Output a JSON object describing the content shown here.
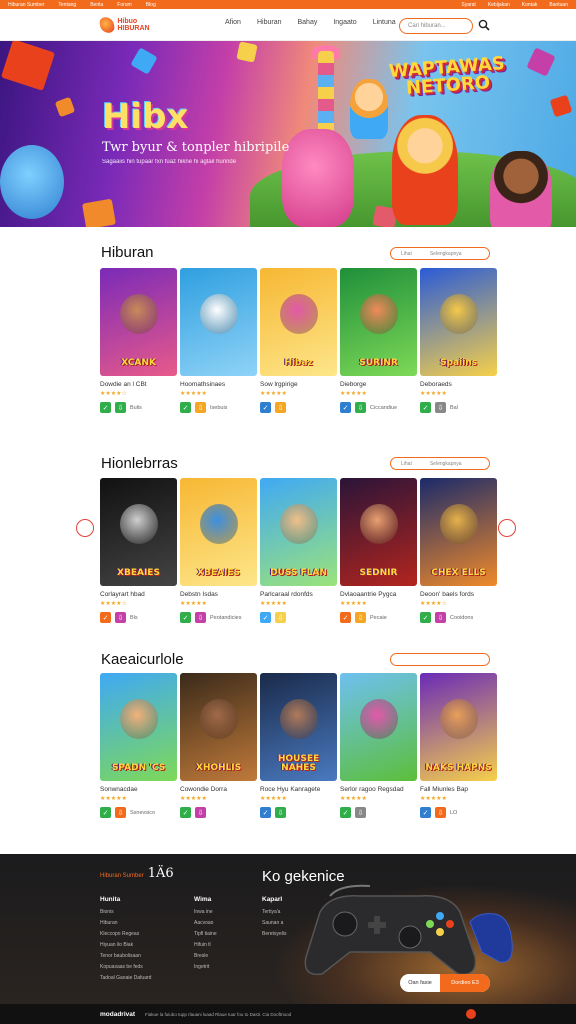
{
  "topbar": {
    "left": [
      "Hiburan Sumber",
      "Tentang",
      "Berita",
      "Forum",
      "Blog"
    ],
    "right": [
      "Syarat",
      "Kebijakan",
      "Kontak",
      "Bantuan"
    ]
  },
  "header": {
    "logo_text": "Hibuo HIBURAN",
    "nav": [
      "Afion",
      "Hiburan",
      "Bahay",
      "Ingaato",
      "Lintuna"
    ],
    "search_placeholder": "Cari hiburan..."
  },
  "hero": {
    "title": "Hibx",
    "subtitle": "Twr byur & tonpler hibripile",
    "caption": "Sagaaiis hin tupaar fxn fuaz hikne hi agtail hunnde",
    "badge": "WAPTAWAS NETORO"
  },
  "sections": [
    {
      "title": "Hiburan",
      "more": [
        "Lihat",
        "Selengkapnya"
      ],
      "cards": [
        {
          "thumb": "XCANK",
          "title": "Dowdie an l CBt",
          "stars": "★★★★☆",
          "action": "Bulis",
          "c1": "#7a2ab8",
          "c2": "#e85a8a",
          "face": "#c98a5a"
        },
        {
          "thumb": "",
          "title": "Hoomathsinaes",
          "stars": "★★★★★",
          "action": "Isebuis",
          "c1": "#2f9fe0",
          "c2": "#8fd3f7",
          "face": "#ffffff"
        },
        {
          "thumb": "Hibaz",
          "title": "Sow lrgpirige",
          "stars": "★★★★★",
          "action": "",
          "c1": "#f7b733",
          "c2": "#fde68a",
          "face": "#e35aa8"
        },
        {
          "thumb": "SURINR",
          "title": "Dieborge",
          "stars": "★★★★★",
          "action": "Ciccandiue",
          "c1": "#1e8f3a",
          "c2": "#7ed957",
          "face": "#f08a5a"
        },
        {
          "thumb": "Spaiins",
          "title": "Deboraeds",
          "stars": "★★★★★",
          "action": "Bal",
          "c1": "#2a5bd7",
          "c2": "#f6d04a",
          "face": "#f6c94a"
        }
      ]
    },
    {
      "title": "Hionlebrras",
      "more": [
        "Lihat",
        "Selengkapnya"
      ],
      "cards": [
        {
          "thumb": "XBEAIES",
          "title": "Corlayrart hbad",
          "stars": "★★★★☆",
          "action": "Bls",
          "c1": "#111111",
          "c2": "#444444",
          "face": "#cfcfcf"
        },
        {
          "thumb": "XBEAIES",
          "title": "Debstn Isdas",
          "stars": "★★★★★",
          "action": "Peotandicies",
          "c1": "#f7b733",
          "c2": "#fde68a",
          "face": "#3e8fe0"
        },
        {
          "thumb": "DUSS FLAN",
          "title": "Parlcaraal rdonfds",
          "stars": "★★★★★",
          "action": "",
          "c1": "#3fa9f5",
          "c2": "#9be37a",
          "face": "#f0c08a"
        },
        {
          "thumb": "SEDNIR",
          "title": "Dvlaoaantrie Pygca",
          "stars": "★★★★★",
          "action": "Pecaie",
          "c1": "#2a1438",
          "c2": "#b3251e",
          "face": "#e8a070"
        },
        {
          "thumb": "CHEX ELLS",
          "title": "Deoon' baels fords",
          "stars": "★★★★☆",
          "action": "Cooidons",
          "c1": "#1a2a6b",
          "c2": "#f08a2a",
          "face": "#e6b24a"
        }
      ]
    },
    {
      "title": "Kaeaicurlole",
      "more": [
        "",
        ""
      ],
      "cards": [
        {
          "thumb": "SPADN 'CS",
          "title": "Sonwnacdae",
          "stars": "★★★★★",
          "action": "Ssnevsico",
          "c1": "#3fa9f5",
          "c2": "#7ed957",
          "face": "#f2b27a"
        },
        {
          "thumb": "XHOHLIS",
          "title": "Cowondie Dorra",
          "stars": "★★★★★",
          "action": "",
          "c1": "#3a2a1a",
          "c2": "#c07a3a",
          "face": "#a06a4a"
        },
        {
          "thumb": "HOUSEE NAHES",
          "title": "Roce Hyu Kanragete",
          "stars": "★★★★★",
          "action": "",
          "c1": "#1a2a4a",
          "c2": "#4a7ac0",
          "face": "#b07a5a"
        },
        {
          "thumb": "",
          "title": "Serlor ragoo Regsdad",
          "stars": "★★★★★",
          "action": "",
          "c1": "#6ec0f0",
          "c2": "#5cbf3a",
          "face": "#e35aa8"
        },
        {
          "thumb": "NAKS HAPNS",
          "title": "Fall Miunles Bap",
          "stars": "★★★★★",
          "action": "LO",
          "c1": "#6a2ab8",
          "c2": "#f6d04a",
          "face": "#e8a05a"
        }
      ]
    }
  ],
  "footer": {
    "brand_small": "Hiburan Sumber",
    "brand_big": "1Ä6",
    "headline": "Ko gekenice",
    "columns": [
      {
        "heading": "Hunita",
        "items": [
          "Bionis",
          "Hiburan",
          "Kleccopo Regeas",
          "Hiyuan ilo Biak",
          "Tenor baubolisaan",
          "Kopuasaas be feds",
          "Tadoal Gaoaie Dafuard"
        ]
      },
      {
        "heading": "Wima",
        "items": [
          "Inwa ine",
          "Aacvoao",
          "Tipfl tiaine",
          "Hifuin tl",
          "Bresle",
          "Ingetrit"
        ]
      },
      {
        "heading": "Kaparl",
        "items": [
          "Tertiya'a",
          "Saunan a",
          "Beretsyelis"
        ]
      }
    ],
    "pill": [
      "Oan fasie",
      "Dordieo"
    ],
    "pill_icon": "E3"
  },
  "bottom": {
    "logo": "modadrivat",
    "text": "Fiakue la fuiubo tupp rlauani luaad Rlaue tuar fou to Dasti. Cia Dooftriood"
  },
  "colors": {
    "accent": "#f26b1d",
    "star": "#f5a623"
  }
}
